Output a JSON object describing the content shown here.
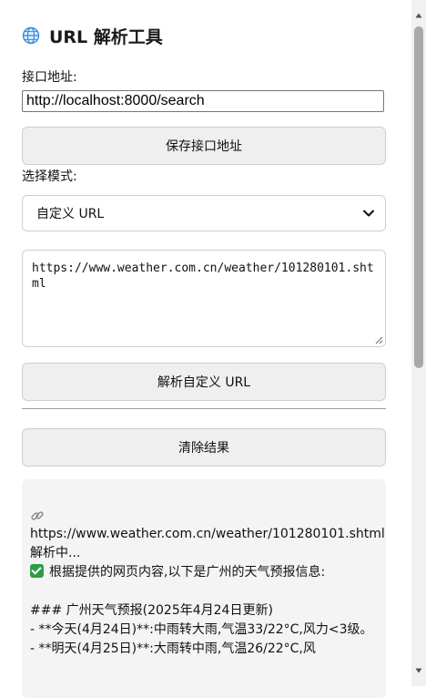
{
  "app": {
    "title": "URL 解析工具"
  },
  "api": {
    "label": "接口地址:",
    "value": "http://localhost:8000/search",
    "save_button": "保存接口地址"
  },
  "mode": {
    "label": "选择模式:",
    "selected": "自定义 URL"
  },
  "custom_url": {
    "value": "https://www.weather.com.cn/weather/101280101.shtml"
  },
  "actions": {
    "parse_button": "解析自定义 URL",
    "clear_button": "清除结果"
  },
  "result": {
    "url": "https://www.weather.com.cn/weather/101280101.shtml",
    "status": "解析中...",
    "intro": "根据提供的网页内容,以下是广州的天气预报信息:",
    "heading": "### 广州天气预报(2025年4月24日更新)",
    "line1": "- **今天(4月24日)**:中雨转大雨,气温33/22°C,风力<3级。",
    "line2": "- **明天(4月25日)**:大雨转中雨,气温26/22°C,风"
  },
  "icons": {
    "globe": "globe-icon",
    "link": "link-icon",
    "check": "check-icon"
  },
  "colors": {
    "check_green": "#2e9e44",
    "button_bg": "#efefef",
    "result_bg": "#f4f4f4"
  }
}
